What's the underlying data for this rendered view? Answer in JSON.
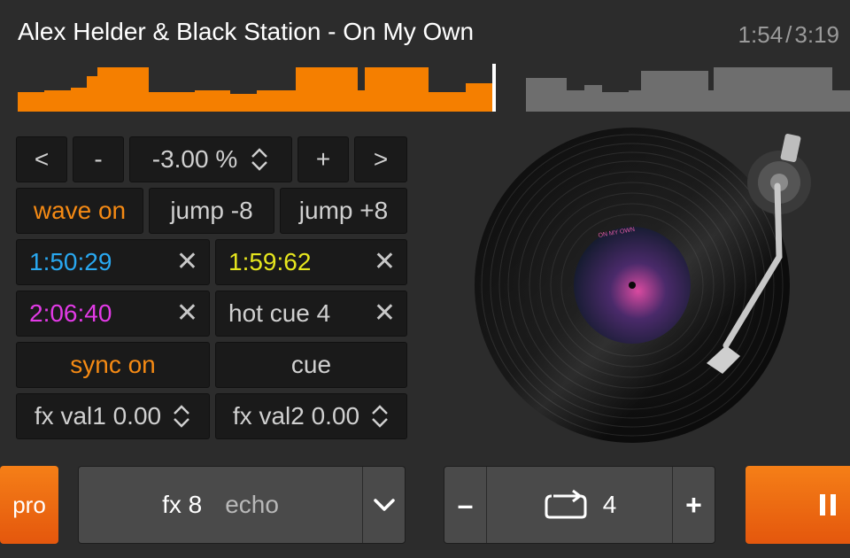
{
  "track": {
    "title": "Alex Helder & Black Station - On My Own",
    "elapsed": "1:54",
    "separator": "/",
    "duration": "3:19",
    "progress": 0.5727
  },
  "controls": {
    "nudge_back": "<",
    "pitch_minus": "-",
    "pitch_value": "-3.00 %",
    "pitch_plus": "+",
    "nudge_forward": ">",
    "wave_toggle": "wave on",
    "jump_back": "jump -8",
    "jump_forward": "jump +8",
    "hot_cues": [
      {
        "label": "1:50:29",
        "color": "#29a8f0",
        "clear": "✕"
      },
      {
        "label": "1:59:62",
        "color": "#e6e61e",
        "clear": "✕"
      },
      {
        "label": "2:06:40",
        "color": "#e23ae6",
        "clear": "✕"
      },
      {
        "label": "hot cue 4",
        "color": "#d0d0d0",
        "clear": "✕"
      }
    ],
    "sync": "sync on",
    "cue": "cue",
    "fx_val1": "fx val1 0.00",
    "fx_val2": "fx val2 0.00"
  },
  "record": {
    "label_text": "ON MY OWN"
  },
  "bottom": {
    "pro": "pro",
    "fx_number": "fx 8",
    "fx_name": "echo",
    "loop_minus": "–",
    "loop_value": "4",
    "loop_plus": "+"
  },
  "colors": {
    "accent": "#f58a14",
    "played_wave": "#f57f00",
    "unplayed_wave": "#6e6e6e"
  }
}
